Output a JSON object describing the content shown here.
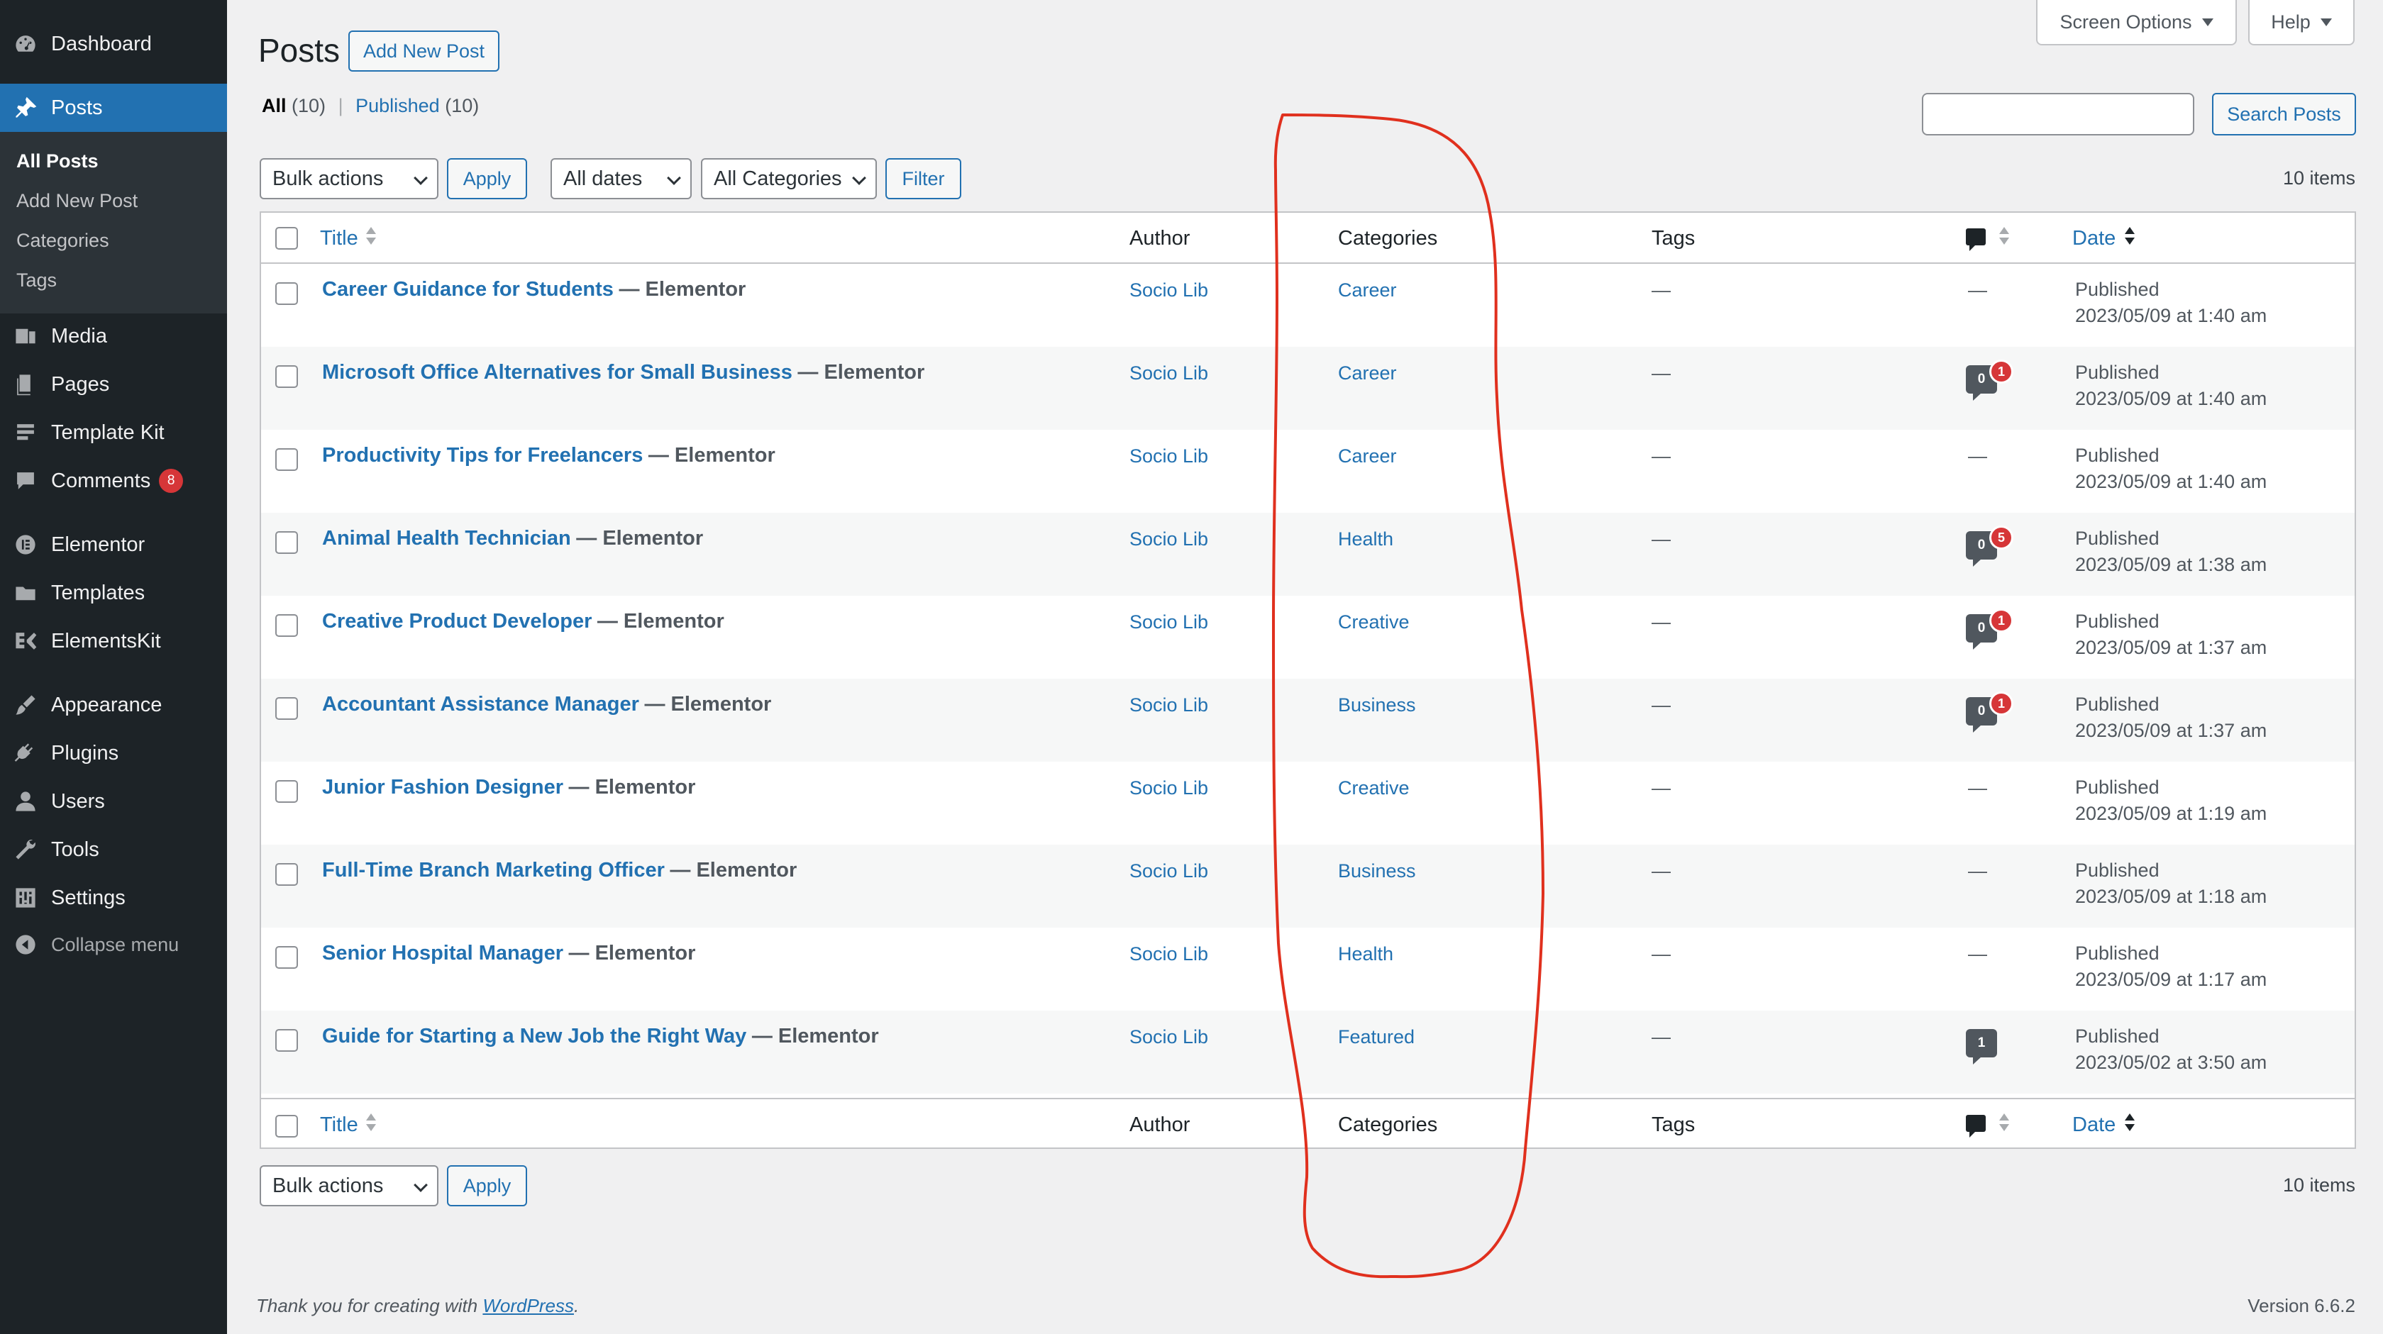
{
  "sidebar": {
    "items": [
      {
        "label": "Dashboard",
        "icon": "dashboard-icon"
      },
      {
        "label": "Posts",
        "icon": "pin-icon"
      },
      {
        "label": "Media",
        "icon": "media-icon"
      },
      {
        "label": "Pages",
        "icon": "pages-icon"
      },
      {
        "label": "Template Kit",
        "icon": "template-kit-icon"
      },
      {
        "label": "Comments",
        "icon": "comments-icon",
        "badge": "8"
      },
      {
        "label": "Elementor",
        "icon": "elementor-icon"
      },
      {
        "label": "Templates",
        "icon": "folder-icon"
      },
      {
        "label": "ElementsKit",
        "icon": "elementskit-icon"
      },
      {
        "label": "Appearance",
        "icon": "brush-icon"
      },
      {
        "label": "Plugins",
        "icon": "plug-icon"
      },
      {
        "label": "Users",
        "icon": "users-icon"
      },
      {
        "label": "Tools",
        "icon": "wrench-icon"
      },
      {
        "label": "Settings",
        "icon": "settings-icon"
      },
      {
        "label": "Collapse menu",
        "icon": "collapse-icon"
      }
    ],
    "submenu": [
      "All Posts",
      "Add New Post",
      "Categories",
      "Tags"
    ]
  },
  "top": {
    "screen_options": "Screen Options",
    "help": "Help"
  },
  "header": {
    "title": "Posts",
    "add_new": "Add New Post"
  },
  "filters": {
    "all_label": "All",
    "all_count": "(10)",
    "published_label": "Published",
    "published_count": "(10)",
    "separator": "|",
    "search_button": "Search Posts",
    "bulk_actions": "Bulk actions",
    "apply": "Apply",
    "all_dates": "All dates",
    "all_categories": "All Categories",
    "filter": "Filter",
    "items_count": "10 items"
  },
  "table": {
    "columns": {
      "title": "Title",
      "author": "Author",
      "categories": "Categories",
      "tags": "Tags",
      "date": "Date"
    },
    "rows": [
      {
        "title": "Career Guidance for Students",
        "state": "— Elementor",
        "author": "Socio Lib",
        "category": "Career",
        "tags": "—",
        "comments": "—",
        "approved": "",
        "pending": "",
        "status": "Published",
        "date": "2023/05/09 at 1:40 am"
      },
      {
        "title": "Microsoft Office Alternatives for Small Business",
        "state": "— Elementor",
        "author": "Socio Lib",
        "category": "Career",
        "tags": "—",
        "comments": "",
        "approved": "0",
        "pending": "1",
        "status": "Published",
        "date": "2023/05/09 at 1:40 am"
      },
      {
        "title": "Productivity Tips for Freelancers",
        "state": "— Elementor",
        "author": "Socio Lib",
        "category": "Career",
        "tags": "—",
        "comments": "—",
        "approved": "",
        "pending": "",
        "status": "Published",
        "date": "2023/05/09 at 1:40 am"
      },
      {
        "title": "Animal Health Technician",
        "state": "— Elementor",
        "author": "Socio Lib",
        "category": "Health",
        "tags": "—",
        "comments": "",
        "approved": "0",
        "pending": "5",
        "status": "Published",
        "date": "2023/05/09 at 1:38 am"
      },
      {
        "title": "Creative Product Developer",
        "state": "— Elementor",
        "author": "Socio Lib",
        "category": "Creative",
        "tags": "—",
        "comments": "",
        "approved": "0",
        "pending": "1",
        "status": "Published",
        "date": "2023/05/09 at 1:37 am"
      },
      {
        "title": "Accountant Assistance Manager",
        "state": "— Elementor",
        "author": "Socio Lib",
        "category": "Business",
        "tags": "—",
        "comments": "",
        "approved": "0",
        "pending": "1",
        "status": "Published",
        "date": "2023/05/09 at 1:37 am"
      },
      {
        "title": "Junior Fashion Designer",
        "state": "— Elementor",
        "author": "Socio Lib",
        "category": "Creative",
        "tags": "—",
        "comments": "—",
        "approved": "",
        "pending": "",
        "status": "Published",
        "date": "2023/05/09 at 1:19 am"
      },
      {
        "title": "Full-Time Branch Marketing Officer",
        "state": "— Elementor",
        "author": "Socio Lib",
        "category": "Business",
        "tags": "—",
        "comments": "—",
        "approved": "",
        "pending": "",
        "status": "Published",
        "date": "2023/05/09 at 1:18 am"
      },
      {
        "title": "Senior Hospital Manager",
        "state": "— Elementor",
        "author": "Socio Lib",
        "category": "Health",
        "tags": "—",
        "comments": "—",
        "approved": "",
        "pending": "",
        "status": "Published",
        "date": "2023/05/09 at 1:17 am"
      },
      {
        "title": "Guide for Starting a New Job the Right Way",
        "state": "— Elementor",
        "author": "Socio Lib",
        "category": "Featured",
        "tags": "—",
        "comments": "",
        "approved": "1",
        "pending": "",
        "status": "Published",
        "date": "2023/05/02 at 3:50 am"
      }
    ]
  },
  "footer": {
    "thanks_prefix": "Thank you for creating with ",
    "thanks_link": "WordPress",
    "thanks_suffix": ".",
    "version": "Version 6.6.2"
  },
  "colors": {
    "sidebar_bg": "#1d2327",
    "accent": "#2271b1",
    "badge": "#d63638",
    "annotation": "#e0301e"
  }
}
